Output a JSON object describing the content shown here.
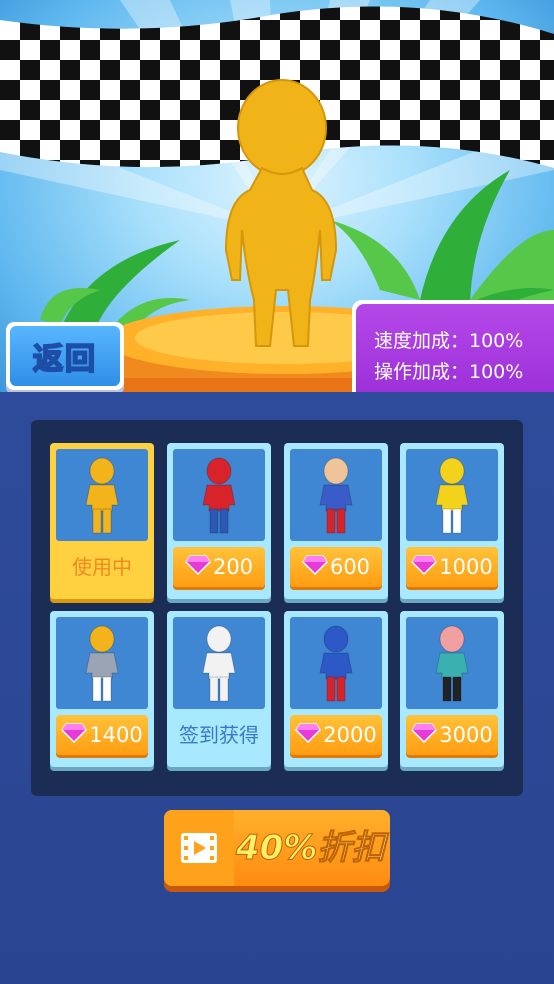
{
  "header": {
    "back_label": "返回",
    "stats": {
      "speed": "速度加成：100%",
      "control": "操作加成：100%"
    }
  },
  "skins": [
    {
      "price": "",
      "status": "使用中",
      "type": "active",
      "head": "#f2b41a",
      "body": "#f2b41a",
      "legs": "#f2b41a"
    },
    {
      "price": "200",
      "status": "",
      "type": "buy",
      "head": "#d8232a",
      "body": "#d8232a",
      "legs": "#2d58b8"
    },
    {
      "price": "600",
      "status": "",
      "type": "buy",
      "head": "#f0c49a",
      "body": "#3a5cc8",
      "legs": "#d8232a"
    },
    {
      "price": "1000",
      "status": "",
      "type": "buy",
      "head": "#f2d21a",
      "body": "#f2d21a",
      "legs": "#ffffff"
    },
    {
      "price": "1400",
      "status": "",
      "type": "buy",
      "head": "#f2b41a",
      "body": "#9aa4b4",
      "legs": "#ffffff"
    },
    {
      "price": "",
      "status": "签到获得",
      "type": "sign",
      "head": "#f2f2f2",
      "body": "#f2f2f2",
      "legs": "#f2f2f2"
    },
    {
      "price": "2000",
      "status": "",
      "type": "buy",
      "head": "#2c58c8",
      "body": "#2c58c8",
      "legs": "#d8232a"
    },
    {
      "price": "3000",
      "status": "",
      "type": "buy",
      "head": "#f0a0a0",
      "body": "#3ab0b0",
      "legs": "#222222"
    }
  ],
  "ad_button": {
    "percent": "40%",
    "label": "折扣"
  },
  "colors": {
    "card": "#a8e9ff",
    "active": "#ffd140",
    "price": "#ff9d12",
    "panel": "#1b2c55",
    "stats": "#9a2fd8"
  },
  "icons": [
    "gem-icon",
    "video-play-icon"
  ]
}
